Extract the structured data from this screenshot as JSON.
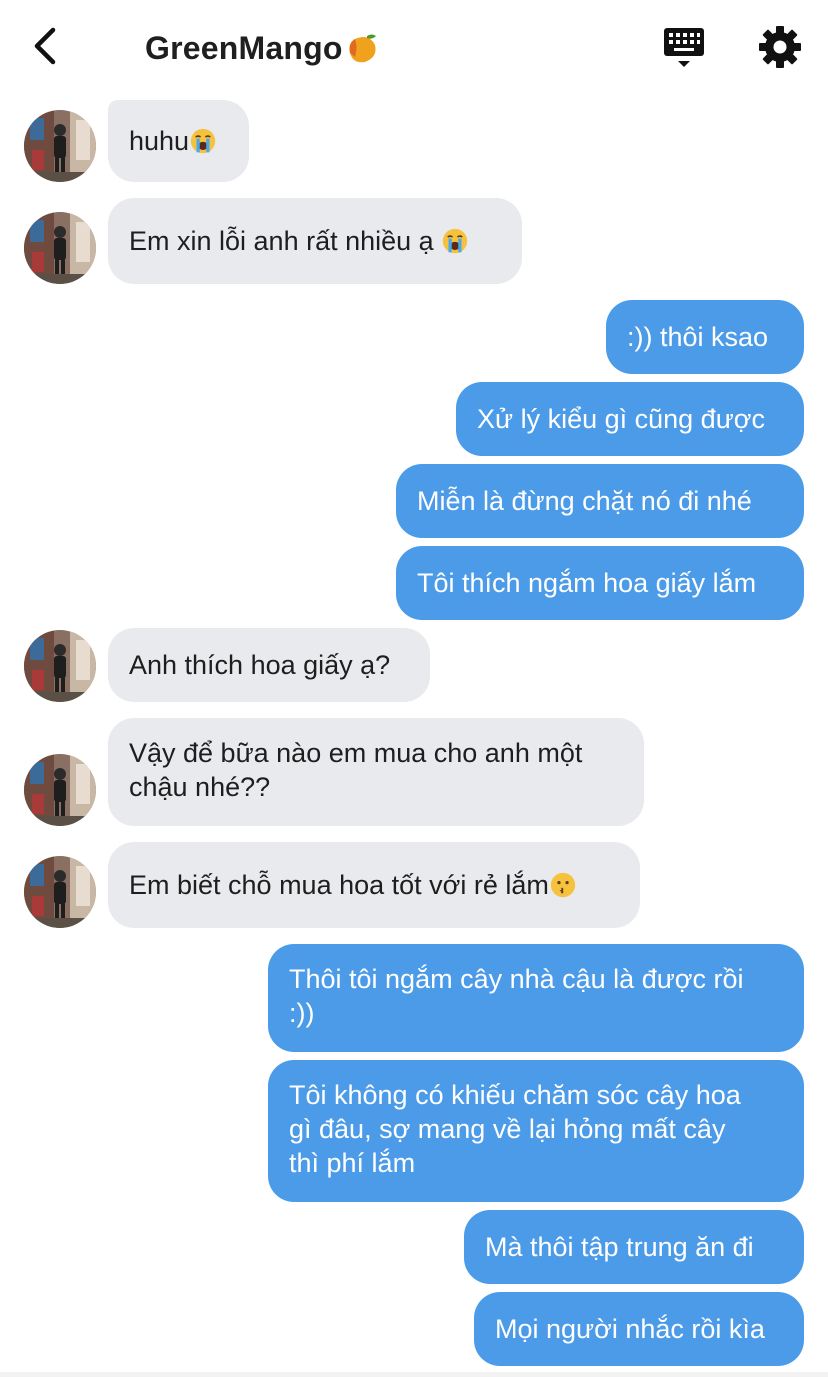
{
  "header": {
    "title": "GreenMango",
    "back_icon": "chevron-left-icon",
    "title_emoji": "mango-icon",
    "keyboard_icon": "keyboard-icon",
    "settings_icon": "gear-icon"
  },
  "colors": {
    "incoming_bubble": "#e9eaed",
    "outgoing_bubble": "#4c9be8",
    "text_dark": "#1e1e1e",
    "text_light": "#ffffff"
  },
  "messages": [
    {
      "from": "them",
      "text": "huhu",
      "emoji": "loudly-crying-face-icon"
    },
    {
      "from": "them",
      "text": "Em xin lỗi anh rất nhiều ạ ",
      "emoji": "loudly-crying-face-icon"
    },
    {
      "from": "me",
      "text": ":)) thôi ksao"
    },
    {
      "from": "me",
      "text": "Xử lý kiểu gì cũng được"
    },
    {
      "from": "me",
      "text": "Miễn là đừng chặt nó đi nhé"
    },
    {
      "from": "me",
      "text": "Tôi thích ngắm hoa giấy lắm"
    },
    {
      "from": "them",
      "text": "Anh thích hoa giấy ạ?"
    },
    {
      "from": "them",
      "lines": [
        "Vậy để bữa nào em mua cho anh một",
        "chậu nhé??"
      ]
    },
    {
      "from": "them",
      "text": "Em biết chỗ mua hoa tốt với rẻ lắm",
      "emoji": "kissing-face-icon"
    },
    {
      "from": "me",
      "lines": [
        "Thôi tôi ngắm cây nhà cậu là được rồi",
        ":))"
      ]
    },
    {
      "from": "me",
      "lines": [
        "Tôi không có khiếu chăm sóc cây hoa",
        "gì đâu, sợ mang về lại hỏng mất cây",
        "thì phí lắm"
      ]
    },
    {
      "from": "me",
      "text": "Mà thôi tập trung ăn đi"
    },
    {
      "from": "me",
      "text": "Mọi người nhắc rồi kìa"
    }
  ]
}
